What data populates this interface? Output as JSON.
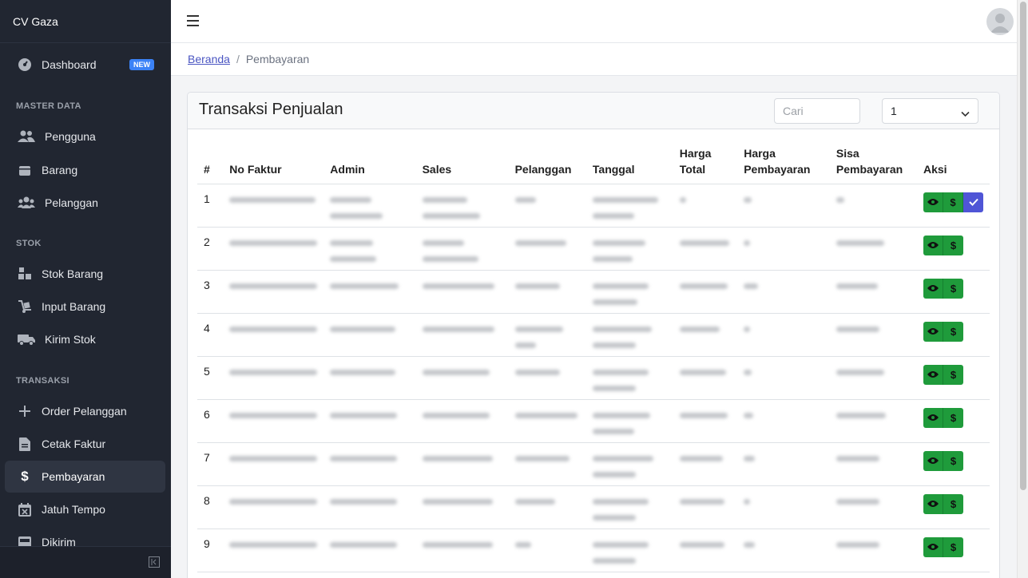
{
  "brand": "CV Gaza",
  "sidebar": {
    "dashboard": "Dashboard",
    "badge": "NEW",
    "master_title": "MASTER DATA",
    "pengguna": "Pengguna",
    "barang": "Barang",
    "pelanggan": "Pelanggan",
    "stok_title": "STOK",
    "stok_barang": "Stok Barang",
    "input_barang": "Input Barang",
    "kirim_stok": "Kirim Stok",
    "transaksi_title": "TRANSAKSI",
    "order_pelanggan": "Order Pelanggan",
    "cetak_faktur": "Cetak Faktur",
    "pembayaran": "Pembayaran",
    "jatuh_tempo": "Jatuh Tempo",
    "dikirim": "Dikirim"
  },
  "breadcrumb": {
    "home": "Beranda",
    "current": "Pembayaran"
  },
  "card": {
    "title": "Transaksi Penjualan",
    "search_placeholder": "Cari",
    "page_select": "1"
  },
  "table": {
    "headers": {
      "num": "#",
      "faktur": "No Faktur",
      "admin": "Admin",
      "sales": "Sales",
      "pelanggan": "Pelanggan",
      "tanggal": "Tanggal",
      "harga_total_1": "Harga",
      "harga_total_2": "Total",
      "harga_bayar_1": "Harga",
      "harga_bayar_2": "Pembayaran",
      "sisa_1": "Sisa",
      "sisa_2": "Pembayaran",
      "aksi": "Aksi"
    },
    "rows": [
      "1",
      "2",
      "3",
      "4",
      "5",
      "6",
      "7",
      "8",
      "9"
    ]
  },
  "colors": {
    "sidebar": "#212631",
    "action_green": "#1f9b3b",
    "action_blue": "#4f55d6"
  }
}
